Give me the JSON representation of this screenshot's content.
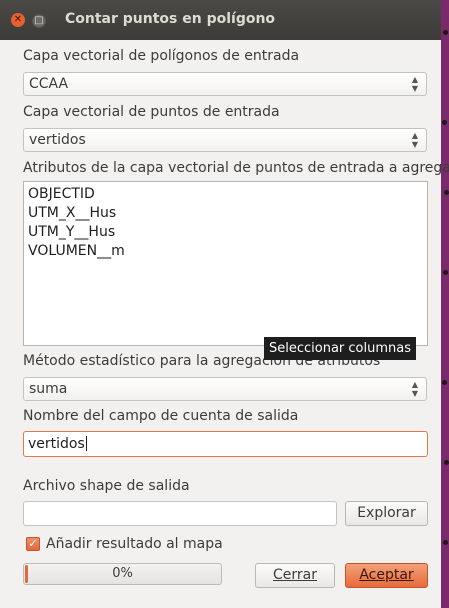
{
  "window": {
    "title": "Contar puntos en polígono"
  },
  "polygon_layer": {
    "label": "Capa vectorial de polígonos de entrada",
    "value": "CCAA"
  },
  "point_layer": {
    "label": "Capa vectorial de puntos de entrada",
    "value": "vertidos"
  },
  "attributes": {
    "label": "Atributos de la capa vectorial de puntos de entrada a agregar",
    "items": [
      "OBJECTID",
      "UTM_X__Hus",
      "UTM_Y__Hus",
      "VOLUMEN__m"
    ],
    "tooltip": "Seleccionar columnas"
  },
  "statistic": {
    "label": "Método estadístico para la agregación de atributos",
    "value": "suma"
  },
  "count_field": {
    "label": "Nombre del campo de cuenta de salida",
    "value": "vertidos"
  },
  "output": {
    "label": "Archivo shape de salida",
    "value": "",
    "browse_label": "Explorar"
  },
  "add_to_map": {
    "label": "Añadir resultado al mapa",
    "checked": true
  },
  "progress": {
    "value": 0,
    "text": "0%"
  },
  "buttons": {
    "close_label": "Cerrar",
    "ok_label": "Aceptar"
  },
  "colors": {
    "accent": "#e4683c",
    "titlebar": "#3c3b37",
    "background_window": "#7a2a6a"
  }
}
